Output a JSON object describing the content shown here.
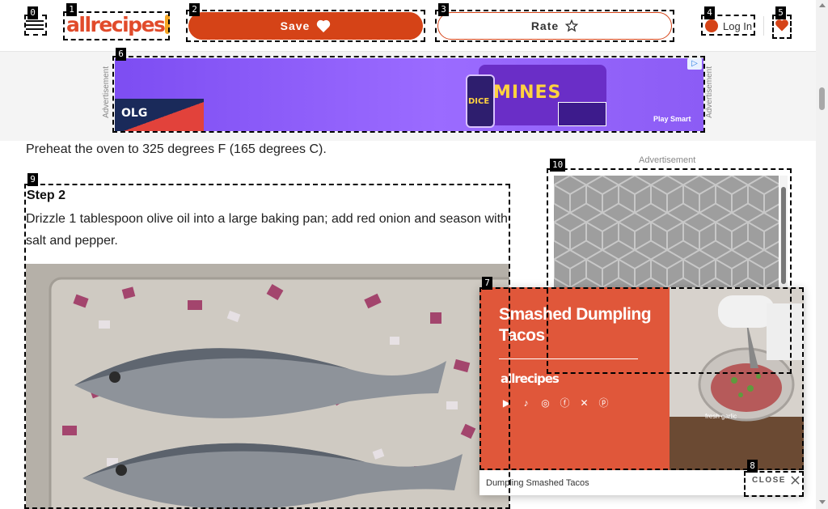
{
  "header": {
    "logo_text": "allrecipes",
    "save_label": "Save",
    "rate_label": "Rate",
    "login_label": "Log In"
  },
  "top_ad": {
    "label": "Advertisement",
    "brand": "OLG",
    "headline": "MINES",
    "tile_text": "DICE",
    "tagline": "Play Smart"
  },
  "article": {
    "step1_text": "Preheat the oven to 325 degrees F (165 degrees C).",
    "step2_title": "Step 2",
    "step2_text": "Drizzle 1 tablespoon olive oil into a large baking pan; add red onion and season with salt and pepper."
  },
  "right_ad": {
    "label": "Advertisement"
  },
  "video": {
    "title": "Smashed Dumpling Tacos",
    "brand": "allrecipes",
    "frame_text": "fresh garlic",
    "caption": "Dumpling Smashed Tacos",
    "close_label": "CLOSE"
  },
  "markers": [
    "0",
    "1",
    "2",
    "3",
    "4",
    "5",
    "6",
    "7",
    "8",
    "9",
    "10"
  ],
  "colors": {
    "brand_orange": "#d54317",
    "video_bg": "#e0573a",
    "ad_purple": "#8c5cf5"
  }
}
